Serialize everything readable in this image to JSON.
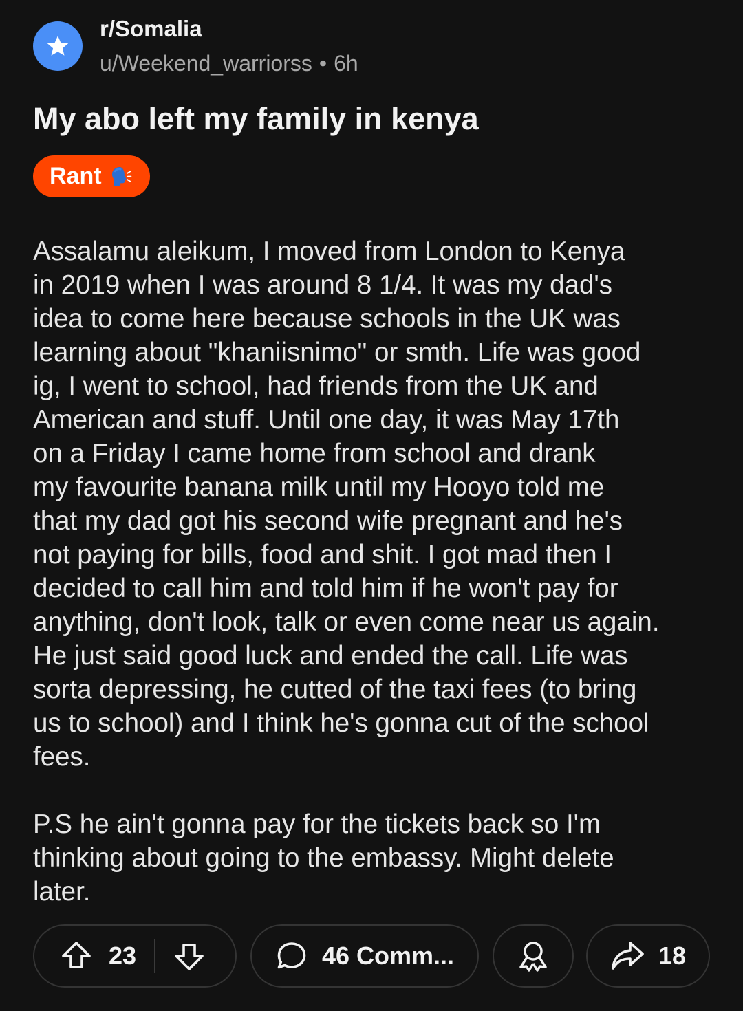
{
  "post": {
    "subreddit": "r/Somalia",
    "author": "u/Weekend_warriorss",
    "separator": "•",
    "time": "6h",
    "title": "My abo left my family in kenya",
    "flair": "Rant",
    "flair_emoji": "speaking-head-icon",
    "body": [
      "Assalamu aleikum, I moved from London to Kenya\nin 2019 when I was around 8 1/4. It was my dad's\nidea to come here because schools in the UK was\nlearning about \"khaniisnimo\" or smth. Life was good\nig, I went to school, had friends from the UK and\nAmerican and stuff. Until one day, it was May 17th\non a Friday I came home from school and drank\nmy favourite banana milk until my Hooyo told me\nthat my dad got his second wife pregnant and he's\nnot paying for bills, food and shit. I got mad then I\ndecided to call him and told him if he won't pay for\nanything, don't look, talk or even come near us again.\nHe just said good luck and ended the call. Life was\nsorta depressing, he cutted of the taxi fees (to bring\nus to school) and I think he's gonna cut of the school\nfees.",
      "P.S he ain't gonna pay for the tickets back so I'm\nthinking about going to the embassy. Might delete\nlater."
    ]
  },
  "actions": {
    "upvotes": "23",
    "comments": "46 Comm...",
    "shares": "18"
  },
  "colors": {
    "background": "#121212",
    "avatar": "#4a8ff7",
    "flair": "#ff4500",
    "meta_text": "#a8a8a8"
  }
}
